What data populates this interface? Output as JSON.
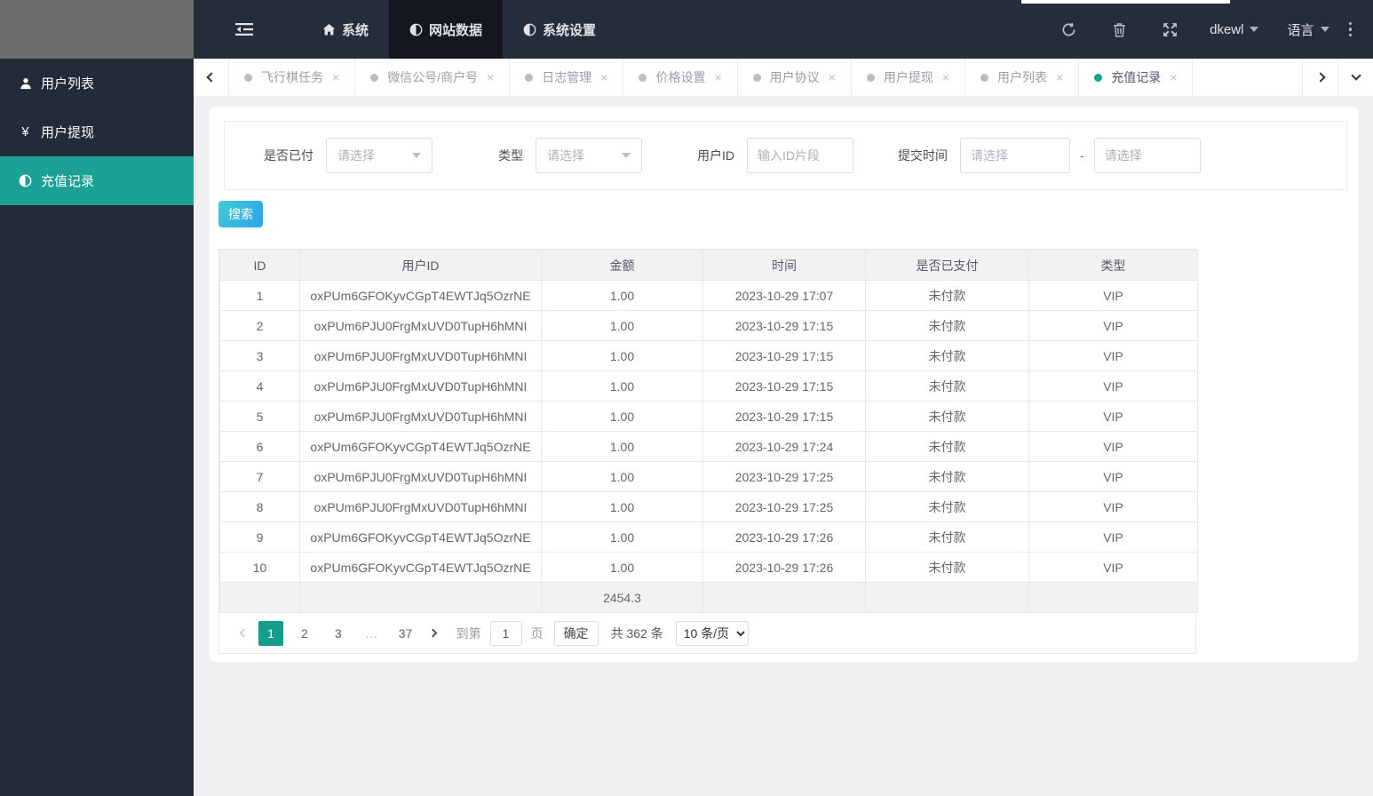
{
  "colors": {
    "accent_teal": "#1aa094",
    "pagination_active": "#149e89",
    "topbar_bg": "#262d3a",
    "sidebar_bg": "#242b38",
    "active_nav_bg": "#14171f",
    "search_gradient_start": "#41cbd4",
    "search_gradient_end": "#2fa3e9"
  },
  "topbar": {
    "toggle_icon": "outdent-icon",
    "nav": [
      {
        "label": "系统",
        "icon": "home-icon",
        "active": false
      },
      {
        "label": "网站数据",
        "icon": "adjust-icon",
        "active": true
      },
      {
        "label": "系统设置",
        "icon": "adjust-icon",
        "active": false
      }
    ],
    "username": "dkewl",
    "language": "语言"
  },
  "tabs": [
    {
      "label": "飞行棋任务",
      "close": "×"
    },
    {
      "label": "微信公号/商户号",
      "close": "×"
    },
    {
      "label": "日志管理",
      "close": "×"
    },
    {
      "label": "价格设置",
      "close": "×"
    },
    {
      "label": "用户协议",
      "close": "×"
    },
    {
      "label": "用户提现",
      "close": "×"
    },
    {
      "label": "用户列表",
      "close": "×"
    },
    {
      "label": "充值记录",
      "close": "×",
      "active": true
    }
  ],
  "sidebar": {
    "items": [
      {
        "label": "用户列表",
        "icon": "user-icon"
      },
      {
        "label": "用户提现",
        "icon": "yen-icon",
        "glyph": "¥"
      },
      {
        "label": "充值记录",
        "icon": "adjust-icon",
        "active": true
      }
    ]
  },
  "filters": {
    "paid": {
      "label": "是否已付",
      "placeholder": "请选择"
    },
    "type": {
      "label": "类型",
      "placeholder": "请选择"
    },
    "user_id": {
      "label": "用户ID",
      "placeholder": "输入ID片段"
    },
    "submit_time": {
      "label": "提交时间",
      "from_placeholder": "请选择",
      "separator": "-",
      "to_placeholder": "请选择"
    }
  },
  "search_button": "搜索",
  "table": {
    "headers": [
      "ID",
      "用户ID",
      "金额",
      "时间",
      "是否已支付",
      "类型"
    ],
    "rows": [
      {
        "id": "1",
        "user_id": "oxPUm6GFOKyvCGpT4EWTJq5OzrNE",
        "amount": "1.00",
        "time": "2023-10-29 17:07",
        "status": "未付款",
        "type": "VIP"
      },
      {
        "id": "2",
        "user_id": "oxPUm6PJU0FrgMxUVD0TupH6hMNI",
        "amount": "1.00",
        "time": "2023-10-29 17:15",
        "status": "未付款",
        "type": "VIP"
      },
      {
        "id": "3",
        "user_id": "oxPUm6PJU0FrgMxUVD0TupH6hMNI",
        "amount": "1.00",
        "time": "2023-10-29 17:15",
        "status": "未付款",
        "type": "VIP"
      },
      {
        "id": "4",
        "user_id": "oxPUm6PJU0FrgMxUVD0TupH6hMNI",
        "amount": "1.00",
        "time": "2023-10-29 17:15",
        "status": "未付款",
        "type": "VIP"
      },
      {
        "id": "5",
        "user_id": "oxPUm6PJU0FrgMxUVD0TupH6hMNI",
        "amount": "1.00",
        "time": "2023-10-29 17:15",
        "status": "未付款",
        "type": "VIP"
      },
      {
        "id": "6",
        "user_id": "oxPUm6GFOKyvCGpT4EWTJq5OzrNE",
        "amount": "1.00",
        "time": "2023-10-29 17:24",
        "status": "未付款",
        "type": "VIP"
      },
      {
        "id": "7",
        "user_id": "oxPUm6PJU0FrgMxUVD0TupH6hMNI",
        "amount": "1.00",
        "time": "2023-10-29 17:25",
        "status": "未付款",
        "type": "VIP"
      },
      {
        "id": "8",
        "user_id": "oxPUm6PJU0FrgMxUVD0TupH6hMNI",
        "amount": "1.00",
        "time": "2023-10-29 17:25",
        "status": "未付款",
        "type": "VIP"
      },
      {
        "id": "9",
        "user_id": "oxPUm6GFOKyvCGpT4EWTJq5OzrNE",
        "amount": "1.00",
        "time": "2023-10-29 17:26",
        "status": "未付款",
        "type": "VIP"
      },
      {
        "id": "10",
        "user_id": "oxPUm6GFOKyvCGpT4EWTJq5OzrNE",
        "amount": "1.00",
        "time": "2023-10-29 17:26",
        "status": "未付款",
        "type": "VIP"
      }
    ],
    "summary_amount": "2454.3"
  },
  "pagination": {
    "pages": [
      {
        "label": "1",
        "active": true
      },
      {
        "label": "2"
      },
      {
        "label": "3"
      },
      {
        "label": "...",
        "ellipsis": true
      },
      {
        "label": "37"
      }
    ],
    "goto_prefix": "到第",
    "goto_value": "1",
    "goto_suffix": "页",
    "confirm_label": "确定",
    "total_label": "共 362 条",
    "page_size": "10 条/页"
  }
}
